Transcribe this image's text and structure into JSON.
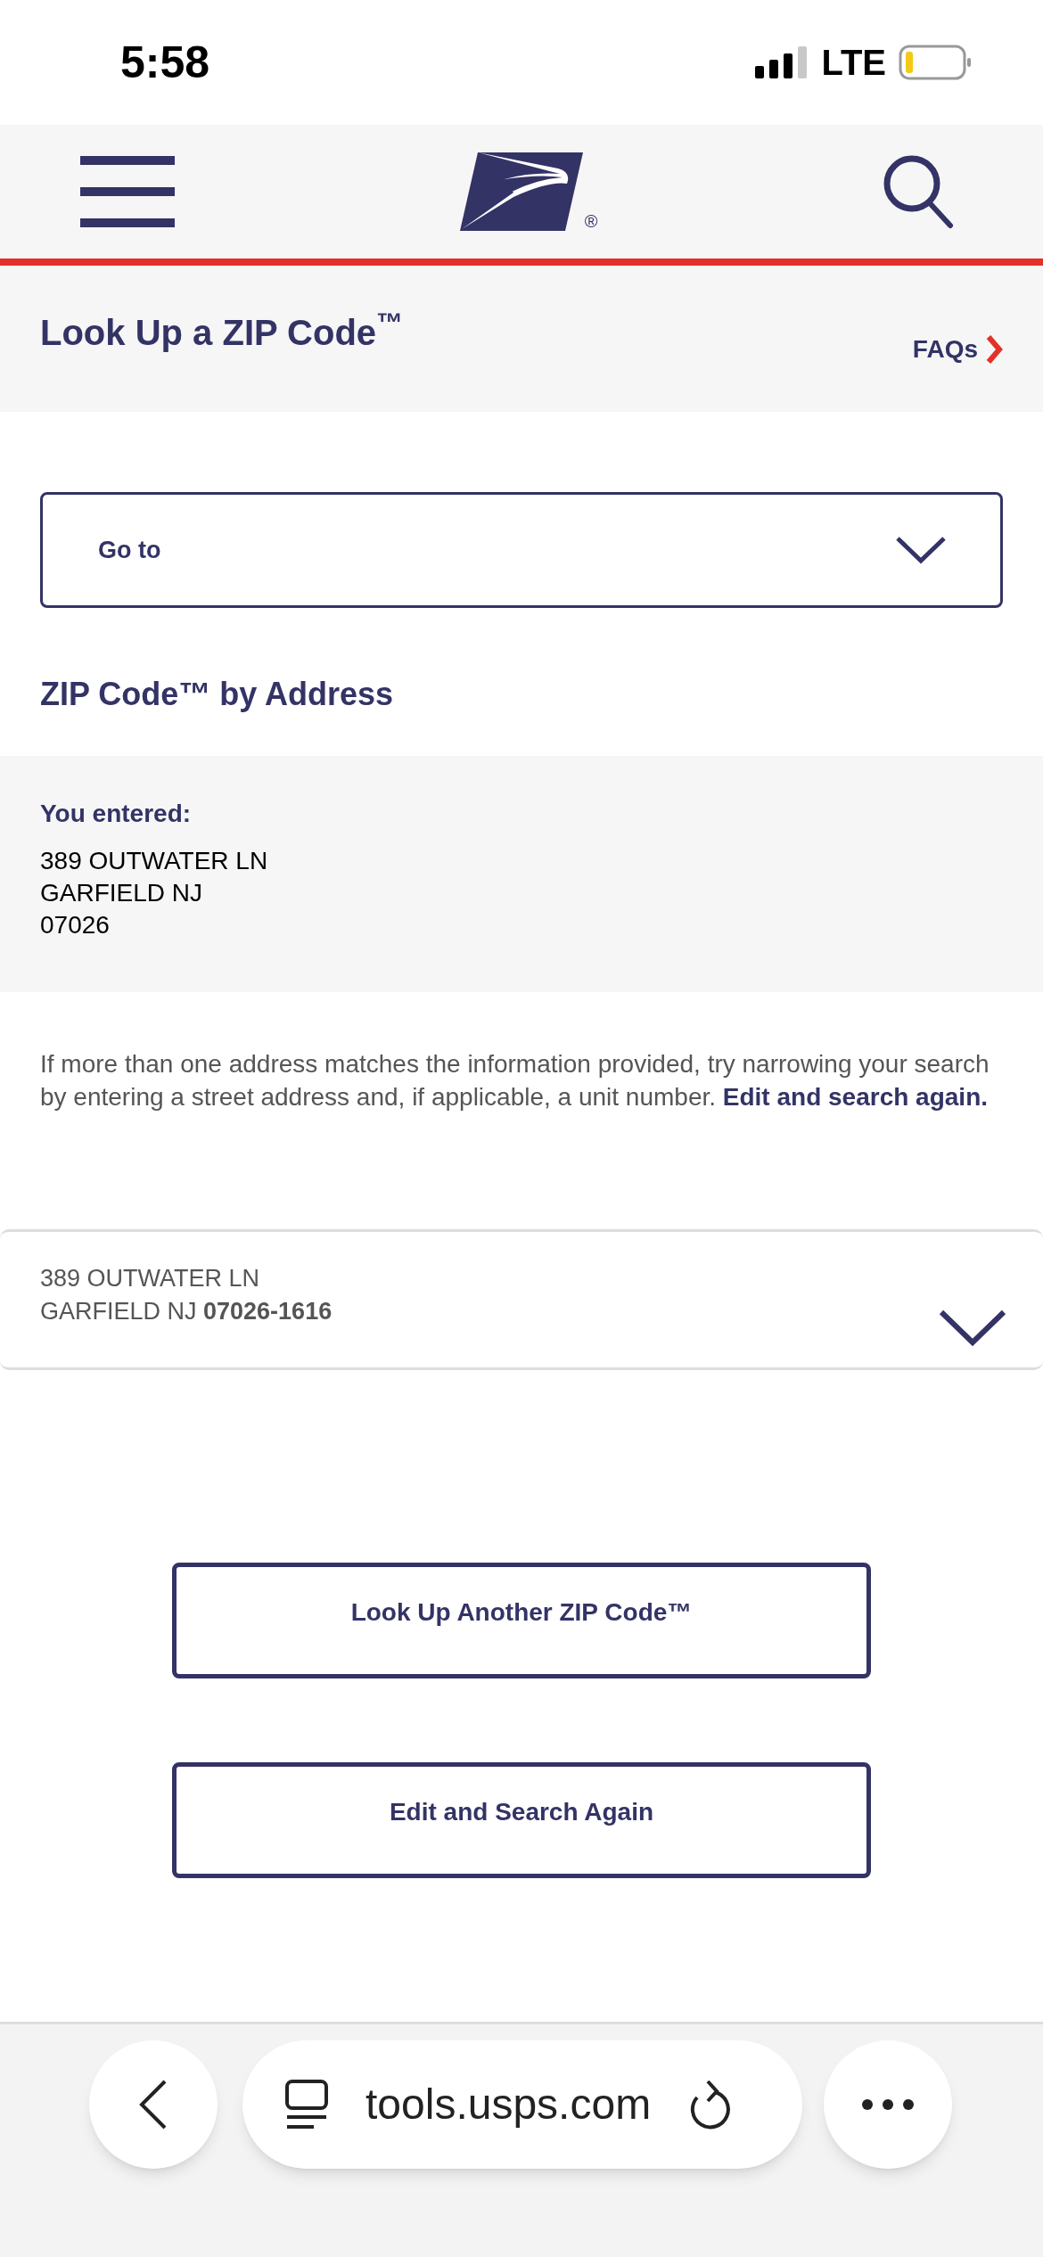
{
  "status_bar": {
    "time": "5:58",
    "network": "LTE"
  },
  "header": {
    "logo_mark": "®"
  },
  "page_title": {
    "title": "Look Up a ZIP Code$^{™}$",
    "faqs_link": "FAQs"
  },
  "goto_dropdown": {
    "label": "Go to"
  },
  "section_title": "ZIP Code™ by Address",
  "entered": {
    "label": "You entered:",
    "lines": [
      "389 OUTWATER LN",
      "GARFIELD NJ",
      "07026"
    ]
  },
  "hint": {
    "text": "If more than one address matches the information provided, try narrowing your search by entering a street address and, if applicable, a unit number.",
    "link": "Edit and search again."
  },
  "results": [
    {
      "lines": [
        "389 OUTWATER LN",
        "GARFIELD NJ **07026-1616**"
      ],
      "expanded": false
    }
  ],
  "buttons": [
    "Look Up Another ZIP Code™",
    "Edit and Search Again"
  ],
  "browser_bar": {
    "url": "tools.usps.com"
  }
}
